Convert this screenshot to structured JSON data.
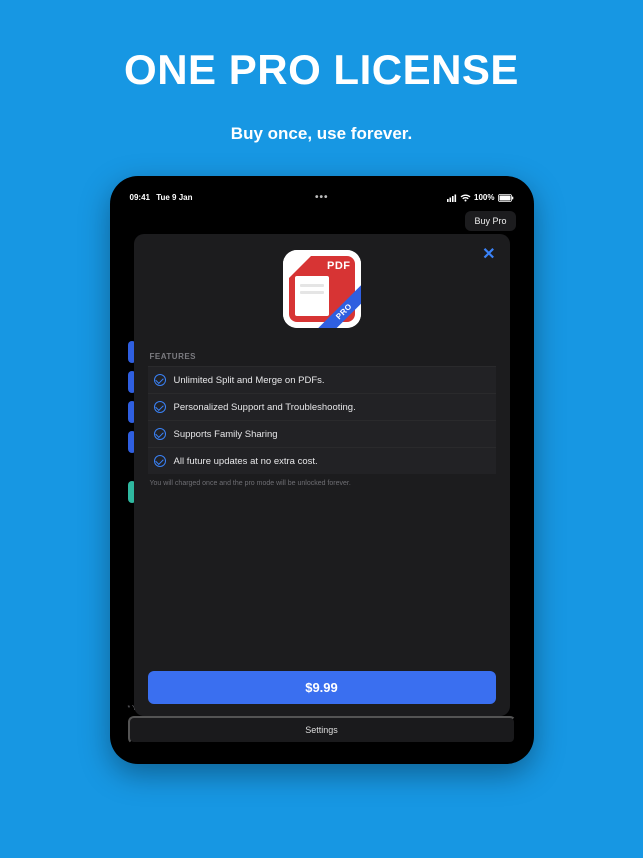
{
  "hero": {
    "title": "ONE PRO LICENSE",
    "subtitle": "Buy once, use forever."
  },
  "statusbar": {
    "time": "09:41",
    "date": "Tue 9 Jan",
    "battery_pct": "100%"
  },
  "navbar": {
    "buy_pro_label": "Buy Pro"
  },
  "modal": {
    "section_header": "FEATURES",
    "features": [
      "Unlimited Split and Merge on PDFs.",
      "Personalized Support and Troubleshooting.",
      "Supports Family Sharing",
      "All future updates at no extra cost."
    ],
    "fine_print": "You will charged once and the pro mode will be unlocked forever.",
    "price_label": "$9.99",
    "icon": {
      "pdf_text": "PDF",
      "pro_text": "PRO"
    }
  },
  "background": {
    "settings_label": "Settings",
    "bottom_note_prefix": "* You"
  }
}
